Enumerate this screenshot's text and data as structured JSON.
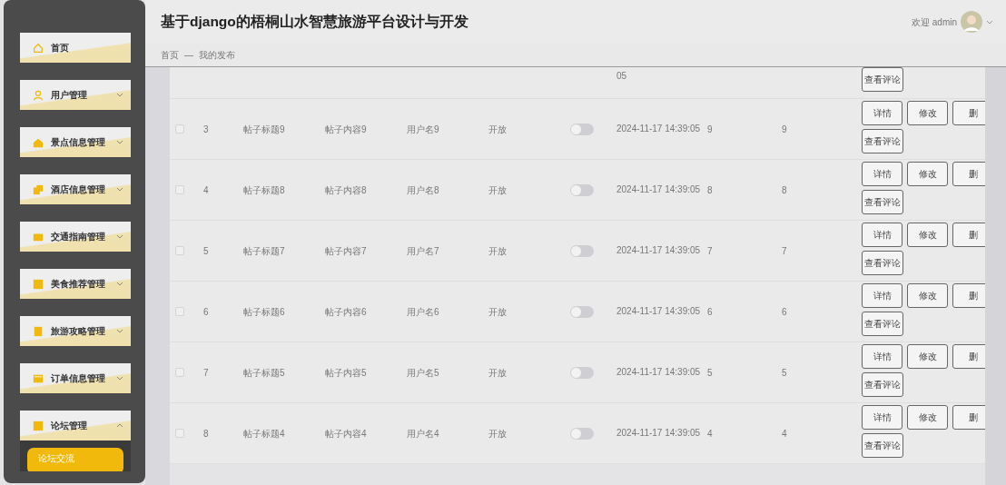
{
  "header": {
    "title": "基于django的梧桐山水智慧旅游平台设计与开发",
    "welcome": "欢迎 admin"
  },
  "breadcrumb": {
    "items": [
      "首页",
      "我的发布"
    ],
    "separator": "—"
  },
  "menu": [
    {
      "label": "首页"
    },
    {
      "label": "用户管理",
      "expanded": false
    },
    {
      "label": "景点信息管理",
      "expanded": false
    },
    {
      "label": "酒店信息管理",
      "expanded": false
    },
    {
      "label": "交通指南管理",
      "expanded": false
    },
    {
      "label": "美食推荐管理",
      "expanded": false
    },
    {
      "label": "旅游攻略管理",
      "expanded": false
    },
    {
      "label": "订单信息管理",
      "expanded": false
    },
    {
      "label": "论坛管理",
      "expanded": true,
      "children": [
        {
          "label": "论坛交流",
          "selected": true
        }
      ]
    }
  ],
  "rows": [
    {
      "partial": true,
      "time": "05",
      "actions": [
        "查看评论"
      ]
    },
    {
      "checked": false,
      "index": "3",
      "title": "帖子标题9",
      "content": "帖子内容9",
      "user": "用户名9",
      "status": "开放",
      "on": false,
      "time": "2024-11-17 14:39:05",
      "col_8": "9",
      "col_9": "9",
      "actions": [
        "详情",
        "修改",
        "删",
        "查看评论"
      ]
    },
    {
      "checked": false,
      "index": "4",
      "title": "帖子标题8",
      "content": "帖子内容8",
      "user": "用户名8",
      "status": "开放",
      "on": false,
      "time": "2024-11-17 14:39:05",
      "col_8": "8",
      "col_9": "8",
      "actions": [
        "详情",
        "修改",
        "删",
        "查看评论"
      ]
    },
    {
      "checked": false,
      "index": "5",
      "title": "帖子标题7",
      "content": "帖子内容7",
      "user": "用户名7",
      "status": "开放",
      "on": false,
      "time": "2024-11-17 14:39:05",
      "col_8": "7",
      "col_9": "7",
      "actions": [
        "详情",
        "修改",
        "删",
        "查看评论"
      ]
    },
    {
      "checked": false,
      "index": "6",
      "title": "帖子标题6",
      "content": "帖子内容6",
      "user": "用户名6",
      "status": "开放",
      "on": false,
      "time": "2024-11-17 14:39:05",
      "col_8": "6",
      "col_9": "6",
      "actions": [
        "详情",
        "修改",
        "删",
        "查看评论"
      ]
    },
    {
      "checked": false,
      "index": "7",
      "title": "帖子标题5",
      "content": "帖子内容5",
      "user": "用户名5",
      "status": "开放",
      "on": false,
      "time": "2024-11-17 14:39:05",
      "col_8": "5",
      "col_9": "5",
      "actions": [
        "详情",
        "修改",
        "删",
        "查看评论"
      ]
    },
    {
      "checked": false,
      "index": "8",
      "title": "帖子标题4",
      "content": "帖子内容4",
      "user": "用户名4",
      "status": "开放",
      "on": false,
      "time": "2024-11-17 14:39:05",
      "col_8": "4",
      "col_9": "4",
      "actions": [
        "详情",
        "修改",
        "删",
        "查看评论"
      ]
    }
  ]
}
